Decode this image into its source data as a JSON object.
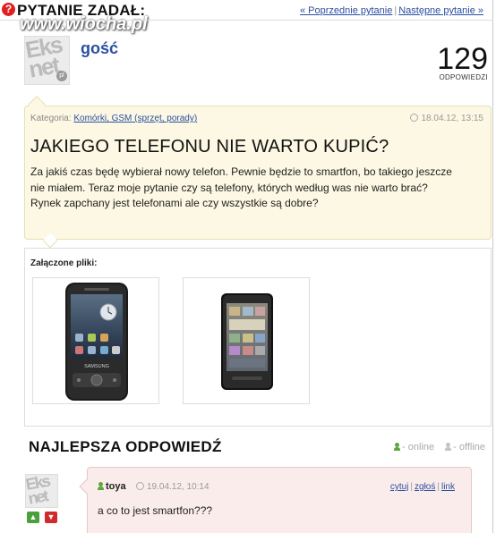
{
  "header": {
    "question_mark": "?",
    "asked_by": "PYTANIE ZADAŁ:",
    "watermark": "www.wiocha.pl",
    "nav": {
      "prev": "« Poprzednie pytanie",
      "next": "Następne pytanie »"
    }
  },
  "author": {
    "avatar_text": "Eks net",
    "avatar_badge": "pl",
    "name": "gość"
  },
  "answers_count": {
    "value": "129",
    "label": "ODPOWIEDZI"
  },
  "question": {
    "category_label": "Kategoria:",
    "category_link": "Komórki, GSM (sprzęt, porady)",
    "date": "18.04.12, 13:15",
    "title": "JAKIEGO TELEFONU NIE WARTO KUPIĆ?",
    "body": "Za jakiś czas będę wybierał nowy telefon. Pewnie będzie to smartfon, bo takiego jeszcze nie miałem. Teraz moje pytanie czy są telefony, których według was nie warto brać? Rynek zapchany jest telefonami ale czy wszystkie są dobre?"
  },
  "attachments": {
    "label": "Załączone pliki:",
    "items": [
      {
        "brand": "SAMSUNG"
      },
      {
        "brand": ""
      }
    ]
  },
  "best_answer": {
    "title": "NAJLEPSZA ODPOWIEDŹ",
    "legend_online": "- online",
    "legend_offline": "- offline",
    "user": "toya",
    "date": "19.04.12, 10:14",
    "actions": {
      "quote": "cytuj",
      "report": "zgłoś",
      "link": "link"
    },
    "text": "a co to jest smartfon???",
    "vote_up": "▲",
    "vote_down": "▼",
    "avatar_text": "Eks net"
  },
  "colors": {
    "link": "#2a4fa0",
    "question_bg": "#fcf8e3",
    "answer_bg": "#fbecec",
    "online": "#5aa83a",
    "vote_up": "#4aa03a",
    "vote_down": "#d22a2a"
  }
}
